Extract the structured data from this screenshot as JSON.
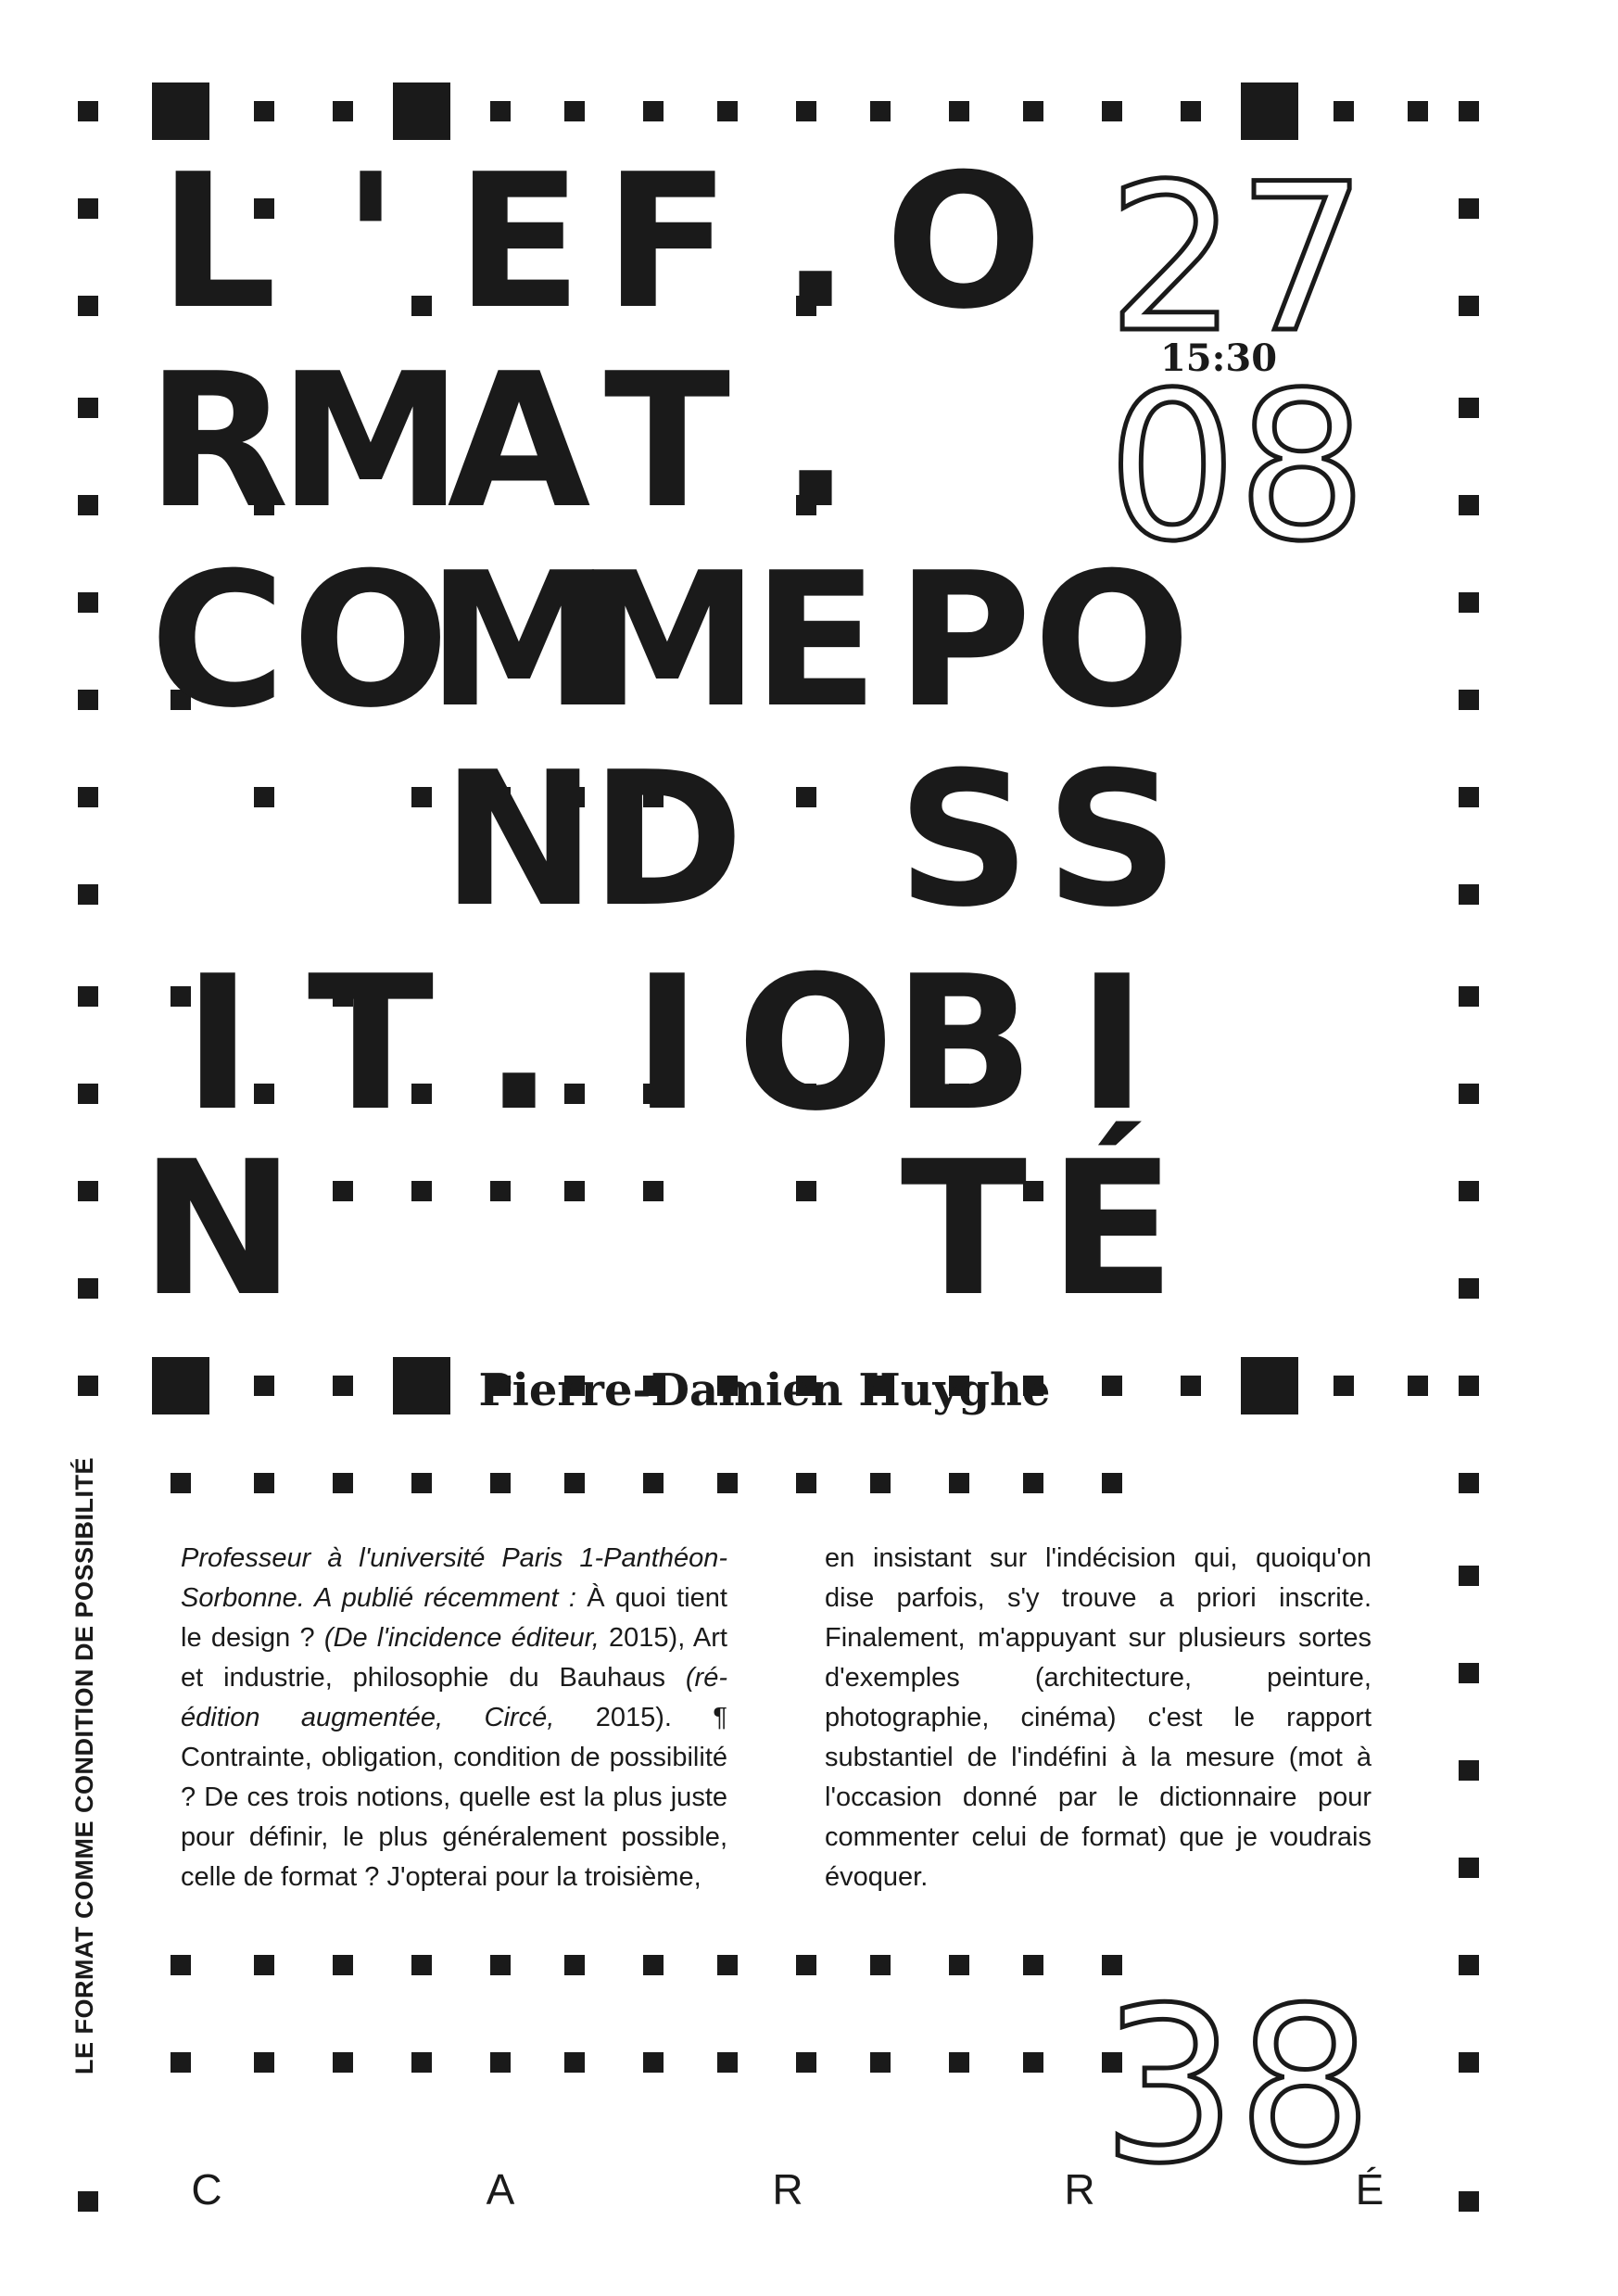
{
  "title_grid": {
    "rows": [
      [
        "L",
        "'",
        "E",
        "F",
        ".",
        "O"
      ],
      [
        "R",
        "M",
        "A",
        "T",
        ".",
        ""
      ],
      [
        "C",
        "O",
        "M",
        "M",
        "E",
        "P",
        "O"
      ],
      [
        "",
        "",
        "N",
        "D",
        "",
        "S",
        "S"
      ],
      [
        "I",
        "T",
        ".",
        "I",
        "O",
        "B",
        "I"
      ],
      [
        "N",
        "",
        "",
        "",
        "",
        "T",
        "É"
      ]
    ]
  },
  "date": {
    "day": "27",
    "month": "08",
    "time": "15:30"
  },
  "author": "Pierre-Damien Huyghe",
  "spine_title": "LE FORMAT COMME CONDITION DE POSSIBILITÉ",
  "issue_number": "38",
  "publication_letters": [
    "C",
    "A",
    "R",
    "R",
    "É"
  ],
  "body": {
    "col1_p1_italic": "Professeur à l'université Paris 1-Panthéon-Sorbonne. A publié récemment : ",
    "col1_p1_t1": "À quoi tient le design ? ",
    "col1_p1_i2": "(De l'incidence éditeur, ",
    "col1_p1_t2": "2015), Art et industrie, philosophie du Bauhaus ",
    "col1_p1_i3": "(ré-édition augmentée, Circé, ",
    "col1_p1_t3": "2015). ¶ Contrainte, obligation, condition de possibilité ? De ces trois notions, quelle est la plus juste pour définir, le plus généralement possible, celle de format ? J'opterai pour la troisième,",
    "col2_text": "en insistant sur l'indécision qui, quoiqu'on dise parfois, s'y trouve a priori inscrite. Finalement, m'appuyant sur plusieurs sortes d'exemples (architecture, peinture, photographie, cinéma) c'est le rapport substantiel de l'indéfini à la mesure (mot à l'occasion donné par le dictionnaire pour commenter celui de format) que je voudrais évoquer."
  }
}
